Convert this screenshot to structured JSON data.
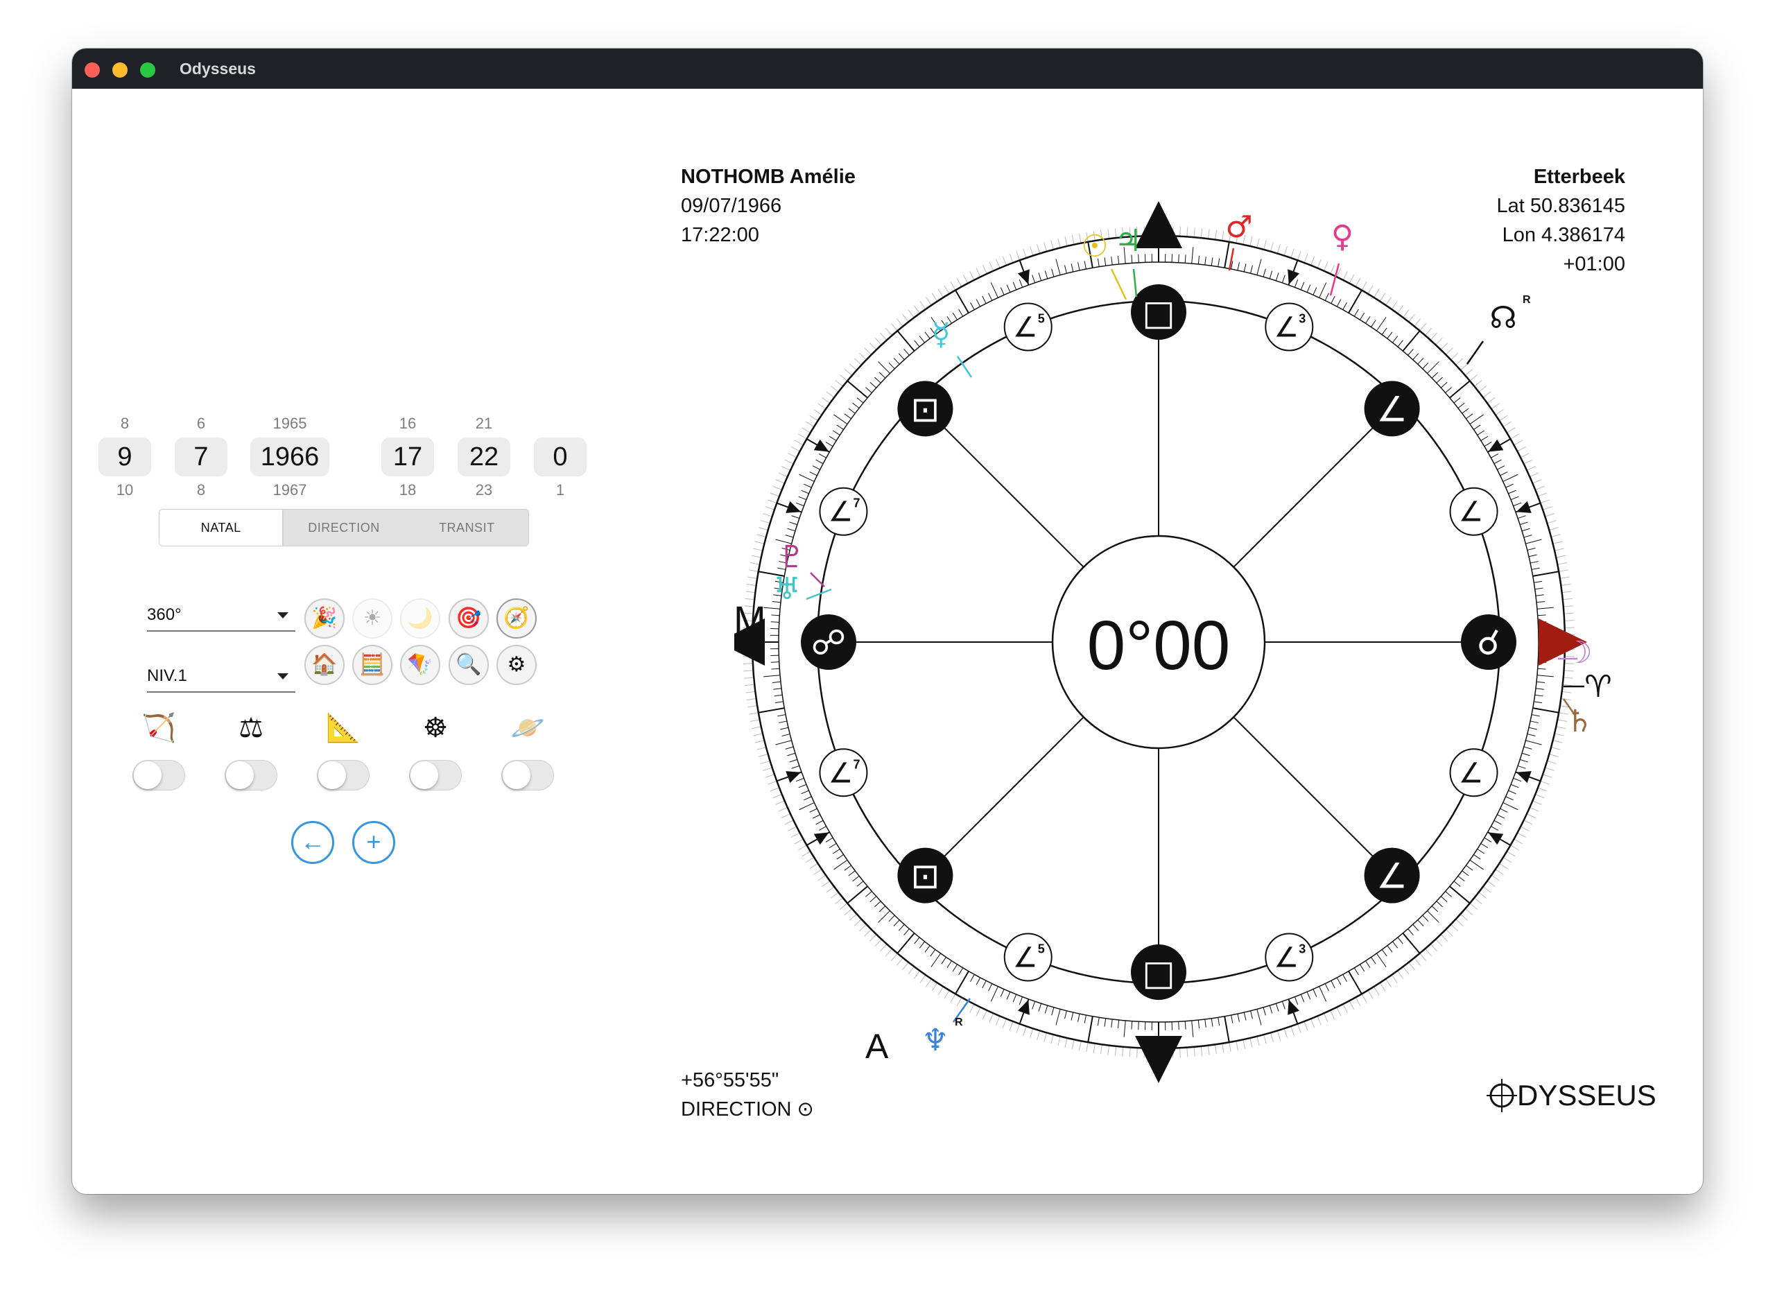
{
  "window": {
    "title": "Odysseus"
  },
  "date_spinners": [
    {
      "prev": "8",
      "value": "9",
      "next": "10"
    },
    {
      "prev": "6",
      "value": "7",
      "next": "8"
    },
    {
      "prev": "1965",
      "value": "1966",
      "next": "1967"
    },
    {
      "prev": "16",
      "value": "17",
      "next": "18"
    },
    {
      "prev": "21",
      "value": "22",
      "next": "23"
    },
    {
      "prev": "",
      "value": "0",
      "next": "1"
    }
  ],
  "mode_tabs": [
    {
      "label": "NATAL",
      "active": true
    },
    {
      "label": "DIRECTION",
      "active": false
    },
    {
      "label": "TRANSIT",
      "active": false
    }
  ],
  "selects": {
    "degrees": "360°",
    "level": "NIV.1"
  },
  "tool_buttons_row1": [
    {
      "icon": "party-popper-icon",
      "glyph": "🎉"
    },
    {
      "icon": "sun-icon",
      "glyph": "☀"
    },
    {
      "icon": "moon-icon",
      "glyph": "🌙"
    },
    {
      "icon": "target-icon",
      "glyph": "🎯"
    },
    {
      "icon": "compass-icon",
      "glyph": "🧭"
    }
  ],
  "tool_buttons_row2": [
    {
      "icon": "house-icon",
      "glyph": "🏠"
    },
    {
      "icon": "abacus-icon",
      "glyph": "🧮"
    },
    {
      "icon": "kite-icon",
      "glyph": "🪁"
    },
    {
      "icon": "magnifier-icon",
      "glyph": "🔍"
    },
    {
      "icon": "gear-icon",
      "glyph": "⚙"
    }
  ],
  "toggle_labels": [
    {
      "icon": "sagittarius-bow-icon",
      "glyph": "🏹"
    },
    {
      "icon": "balance-scale-icon",
      "glyph": "⚖"
    },
    {
      "icon": "set-square-icon",
      "glyph": "📐"
    },
    {
      "icon": "wheel-icon",
      "glyph": "☸"
    },
    {
      "icon": "ringed-planet-icon",
      "glyph": "🪐"
    }
  ],
  "nav_buttons": {
    "back": "←",
    "add": "+"
  },
  "person": {
    "name": "NOTHOMB Amélie",
    "date": "09/07/1966",
    "time": "17:22:00"
  },
  "place": {
    "name": "Etterbeek",
    "lat": "Lat 50.836145",
    "lon": "Lon 4.386174",
    "tz": "+01:00"
  },
  "bottom_left": {
    "angle": "+56°55'55\"",
    "mode": "DIRECTION ⊙"
  },
  "chart_center": "0°00",
  "axis_labels": {
    "mc": "M",
    "asc": "A"
  },
  "logo_text": "DYSSEUS",
  "planets": [
    {
      "glyph": "☉",
      "name": "sun",
      "color": "#e6c11a"
    },
    {
      "glyph": "♃",
      "name": "jupiter",
      "color": "#2fae4a"
    },
    {
      "glyph": "♂",
      "name": "mars",
      "color": "#e02727"
    },
    {
      "glyph": "♀",
      "name": "venus",
      "color": "#e23c8b"
    },
    {
      "glyph": "☊",
      "name": "node",
      "color": "#111111",
      "retro": "R"
    },
    {
      "glyph": "☿",
      "name": "mercury",
      "color": "#3cc7e0"
    },
    {
      "glyph": "♇",
      "name": "pluto",
      "color": "#b53a8e"
    },
    {
      "glyph": "♅",
      "name": "uranus",
      "color": "#3fc6c7"
    },
    {
      "glyph": "☽",
      "name": "moon",
      "color": "#c280d8"
    },
    {
      "glyph": "♈",
      "name": "aries",
      "color": "#111111"
    },
    {
      "glyph": "♄",
      "name": "saturn",
      "color": "#9b6a3c"
    },
    {
      "glyph": "♆",
      "name": "neptune",
      "color": "#3a84d8",
      "retro": "R"
    }
  ],
  "aspect_labels": {
    "a5": "5",
    "a3": "3",
    "a7": "7"
  }
}
